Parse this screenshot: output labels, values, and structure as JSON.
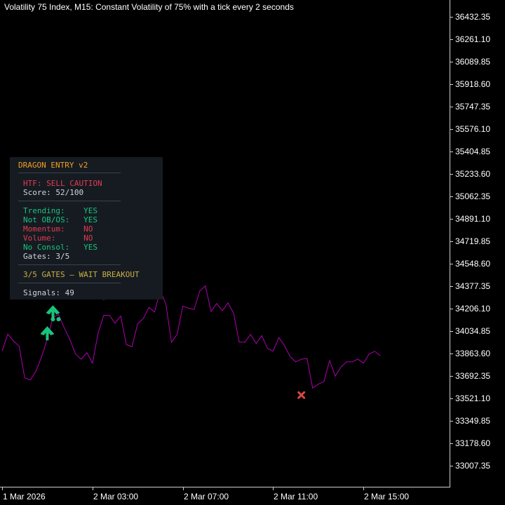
{
  "chart": {
    "title": "Volatility 75 Index, M15:  Constant Volatility of 75% with a tick every 2 seconds",
    "line_color": "#b000b0",
    "background": "#000000"
  },
  "chart_data": {
    "type": "line",
    "title": "Volatility 75 Index, M15:  Constant Volatility of 75% with a tick every 2 seconds",
    "x_ticks": [
      "1 Mar 2026",
      "2 Mar 03:00",
      "2 Mar 07:00",
      "2 Mar 11:00",
      "2 Mar 15:00"
    ],
    "y_ticks": [
      36432.35,
      36261.1,
      36089.85,
      35918.6,
      35747.35,
      35576.1,
      35404.85,
      35233.6,
      35062.35,
      34891.1,
      34719.85,
      34548.6,
      34377.35,
      34206.1,
      34034.85,
      33863.6,
      33692.35,
      33521.1,
      33349.85,
      33178.6,
      33007.35
    ],
    "y_tick_labels": [
      "36432.35",
      "36261.10",
      "36089.85",
      "35918.60",
      "35747.35",
      "35576.10",
      "35404.85",
      "35233.60",
      "35062.35",
      "34891.10",
      "34719.85",
      "34548.60",
      "34377.35",
      "34206.10",
      "34034.85",
      "33863.60",
      "33692.35",
      "33521.10",
      "33349.85",
      "33178.60",
      "33007.35"
    ],
    "bar_count": 64,
    "bars_per_time_tick": 16,
    "series": [
      {
        "color": "#b000b0",
        "values": [
          33882,
          34012,
          33960,
          33920,
          33678,
          33662,
          33730,
          33840,
          33975,
          34140,
          34160,
          34060,
          33970,
          33860,
          33820,
          33870,
          33790,
          34020,
          34155,
          34155,
          34095,
          34150,
          33932,
          33915,
          34090,
          34130,
          34215,
          34180,
          34345,
          34240,
          33950,
          34010,
          34225,
          34210,
          34200,
          34340,
          34380,
          34185,
          34245,
          34190,
          34250,
          34170,
          33950,
          33950,
          34010,
          33940,
          34000,
          33902,
          33882,
          33985,
          33925,
          33840,
          33800,
          33820,
          33825,
          33600,
          33630,
          33650,
          33810,
          33690,
          33760,
          33800,
          33800,
          33820,
          33790,
          33860,
          33880,
          33845
        ]
      }
    ],
    "markers": [
      {
        "type": "buy-arrow",
        "bar": 8,
        "price": 34018,
        "color": "#18c47a"
      },
      {
        "type": "buy-arrow",
        "bar": 9,
        "price": 34178,
        "color": "#18c47a"
      },
      {
        "type": "dot",
        "bar": 9,
        "price": 34125,
        "color": "#18c47a"
      },
      {
        "type": "dot",
        "bar": 10,
        "price": 34125,
        "color": "#18c47a"
      },
      {
        "type": "dot",
        "bar": 18,
        "price": 34290,
        "color": "#ff9900"
      },
      {
        "type": "cross",
        "bar": 53,
        "price": 33546,
        "color": "#d94646"
      }
    ]
  },
  "panel": {
    "title": "DRAGON ENTRY v2",
    "htf": "HTF: SELL CAUTION",
    "score": "Score: 52/100",
    "gates": [
      {
        "label": "Trending:    YES",
        "status": "pass"
      },
      {
        "label": "Not OB/OS:   YES",
        "status": "pass"
      },
      {
        "label": "Momentum:    NO",
        "status": "fail"
      },
      {
        "label": "Volume:      NO",
        "status": "fail"
      },
      {
        "label": "No Consol:   YES",
        "status": "pass"
      }
    ],
    "gates_summary": "Gates: 3/5",
    "verdict": "3/5 GATES — WAIT BREAKOUT",
    "signals": "Signals: 49",
    "colors": {
      "title": "#f0a020",
      "sell": "#e03c50",
      "pass": "#18c47a",
      "fail": "#e03c50",
      "neutral": "#d0d4da",
      "verdict": "#c8b040",
      "background": "#161b22"
    }
  }
}
